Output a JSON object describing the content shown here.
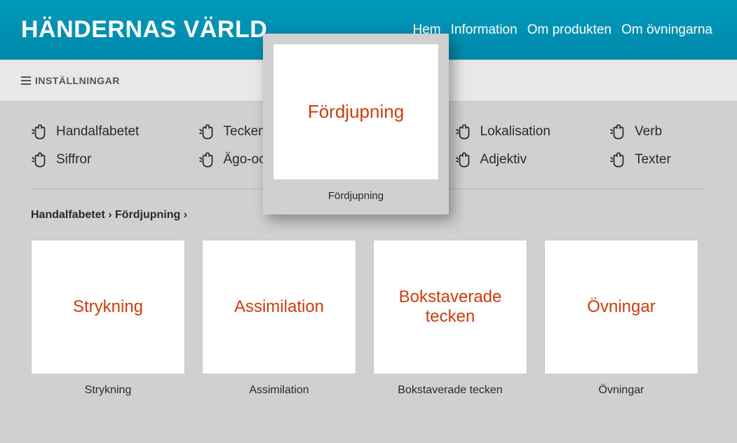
{
  "header": {
    "title": "HÄNDERNAS VÄRLD",
    "nav": {
      "hem": "Hem",
      "information": "Information",
      "om_produkten": "Om produkten",
      "om_ovningarna": "Om övningarna"
    }
  },
  "settings": {
    "label": "INSTÄLLNINGAR"
  },
  "categories": {
    "row0": {
      "c0": "Handalfabetet",
      "c1": "Teckenförråd",
      "c2": "",
      "c3": "Lokalisation",
      "c4": "Verb"
    },
    "row1": {
      "c0": "Siffror",
      "c1": "Ägo-och hjälpv",
      "c2": "",
      "c3": "Adjektiv",
      "c4": "Texter"
    }
  },
  "breadcrumb": "Handalfabetet › Fördjupning ›",
  "cards": {
    "c0": {
      "title": "Strykning",
      "caption": "Strykning"
    },
    "c1": {
      "title": "Assimilation",
      "caption": "Assimilation"
    },
    "c2": {
      "title": "Bokstaverade tecken",
      "caption": "Bokstaverade tecken"
    },
    "c3": {
      "title": "Övningar",
      "caption": "Övningar"
    }
  },
  "popup": {
    "title": "Fördjupning",
    "caption": "Fördjupning"
  }
}
